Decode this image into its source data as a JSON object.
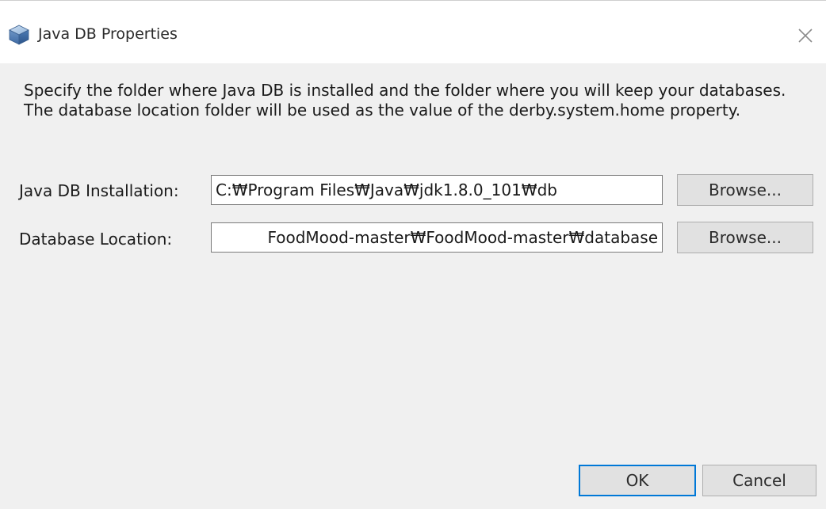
{
  "window": {
    "title": "Java DB Properties",
    "close_icon": "close-icon",
    "app_icon": "java-db-cube-icon"
  },
  "description": "Specify the folder where Java DB is installed and the folder where you will keep your databases. The database location folder will be used as the value of the derby.system.home property.",
  "fields": {
    "installation": {
      "label": "Java DB Installation:",
      "value": "C:₩Program Files₩Java₩jdk1.8.0_101₩db",
      "browse_label": "Browse..."
    },
    "location": {
      "label": "Database Location:",
      "value": "FoodMood-master₩FoodMood-master₩database",
      "browse_label": "Browse..."
    }
  },
  "buttons": {
    "ok_label": "OK",
    "cancel_label": "Cancel"
  },
  "colors": {
    "accent": "#0078d7",
    "dialog_background": "#f0f0f0",
    "button_face": "#e1e1e1"
  }
}
